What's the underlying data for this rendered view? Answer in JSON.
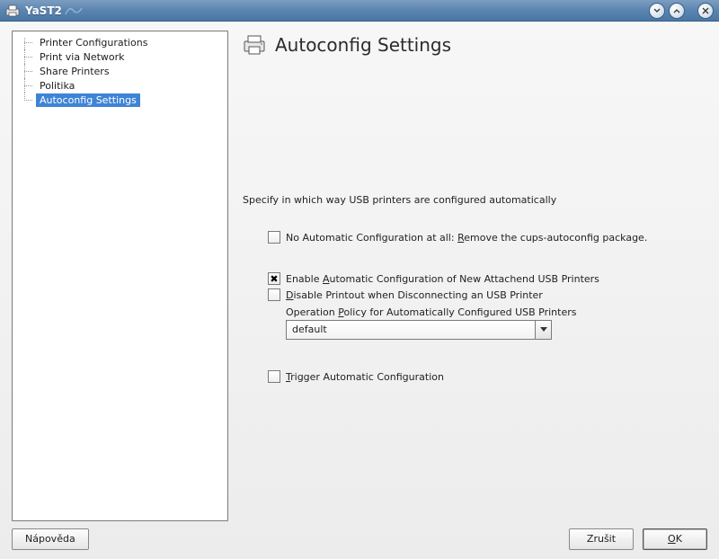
{
  "titlebar": {
    "title": "YaST2"
  },
  "sidebar": {
    "items": [
      {
        "label": "Printer Configurations"
      },
      {
        "label": "Print via Network"
      },
      {
        "label": "Share Printers"
      },
      {
        "label": "Politika"
      },
      {
        "label": "Autoconfig Settings"
      }
    ]
  },
  "content": {
    "heading": "Autoconfig Settings",
    "description": "Specify in which way USB printers are configured automatically",
    "cb_no_auto_pre": "No Automatic Configuration at all: ",
    "cb_no_auto_u": "R",
    "cb_no_auto_post": "emove the cups-autoconfig package.",
    "cb_auto_pre": "Enable ",
    "cb_auto_u": "A",
    "cb_auto_post": "utomatic Configuration of New Attachend USB Printers",
    "cb_disable_u": "D",
    "cb_disable_post": "isable Printout when Disconnecting an USB Printer",
    "policy_pre": "Operation ",
    "policy_u": "P",
    "policy_post": "olicy for Automatically Configured USB Printers",
    "policy_value": "default",
    "cb_trigger_u": "T",
    "cb_trigger_post": "rigger Automatic Configuration"
  },
  "buttons": {
    "help": "Nápověda",
    "cancel": "Zrušit",
    "ok_u": "O",
    "ok_post": "K"
  }
}
